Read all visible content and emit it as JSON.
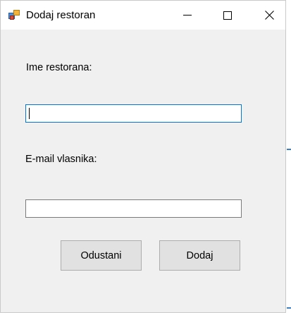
{
  "window": {
    "title": "Dodaj restoran",
    "app_icon": "winforms-app-icon",
    "controls": [
      "minimize-icon",
      "maximize-icon",
      "close-icon"
    ]
  },
  "form": {
    "restaurant_name_label": "Ime restorana:",
    "restaurant_name_value": "",
    "owner_email_label": "E-mail vlasnika:",
    "owner_email_value": ""
  },
  "buttons": {
    "cancel_label": "Odustani",
    "add_label": "Dodaj"
  },
  "colors": {
    "window_bg": "#f0f0f0",
    "titlebar_bg": "#ffffff",
    "focus_border": "#0078d7",
    "button_bg": "#e1e1e1"
  }
}
